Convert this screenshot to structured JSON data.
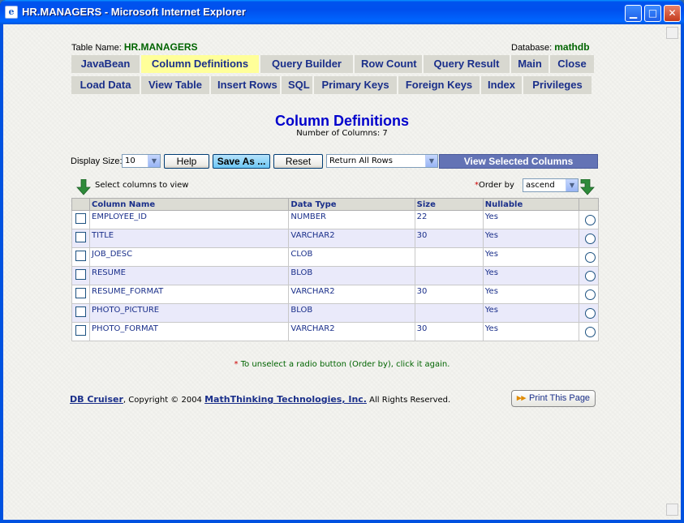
{
  "window": {
    "title": "HR.MANAGERS - Microsoft Internet Explorer"
  },
  "header": {
    "table_name_label": "Table Name:",
    "table_name": "HR.MANAGERS",
    "database_label": "Database:",
    "database": "mathdb"
  },
  "nav_row1": [
    "JavaBean",
    "Column Definitions",
    "Query Builder",
    "Row Count",
    "Query Result",
    "Main",
    "Close"
  ],
  "nav_row2": [
    "Load Data",
    "View Table",
    "Insert Rows",
    "SQL",
    "Primary Keys",
    "Foreign Keys",
    "Index",
    "Privileges"
  ],
  "page": {
    "title": "Column Definitions",
    "subtitle": "Number of Columns: 7"
  },
  "controls": {
    "display_size_label": "Display Size:",
    "display_size_value": "10",
    "help": "Help",
    "save_as": "Save As ...",
    "reset": "Reset",
    "rows_select": "Return All Rows",
    "view_selected": "View Selected Columns",
    "select_cols_label": "Select columns to view",
    "order_by_star": "*",
    "order_by_label": "Order by",
    "order_value": "ascend"
  },
  "table": {
    "headers": [
      "Column Name",
      "Data Type",
      "Size",
      "Nullable"
    ],
    "rows": [
      {
        "name": "EMPLOYEE_ID",
        "type": "NUMBER",
        "size": "22",
        "nullable": "Yes"
      },
      {
        "name": "TITLE",
        "type": "VARCHAR2",
        "size": "30",
        "nullable": "Yes"
      },
      {
        "name": "JOB_DESC",
        "type": "CLOB",
        "size": "",
        "nullable": "Yes"
      },
      {
        "name": "RESUME",
        "type": "BLOB",
        "size": "",
        "nullable": "Yes"
      },
      {
        "name": "RESUME_FORMAT",
        "type": "VARCHAR2",
        "size": "30",
        "nullable": "Yes"
      },
      {
        "name": "PHOTO_PICTURE",
        "type": "BLOB",
        "size": "",
        "nullable": "Yes"
      },
      {
        "name": "PHOTO_FORMAT",
        "type": "VARCHAR2",
        "size": "30",
        "nullable": "Yes"
      }
    ]
  },
  "note": {
    "star": "*",
    "text": " To unselect a radio button (Order by), click it again."
  },
  "footer": {
    "product": "DB Cruiser",
    "copyright": ",  Copyright © 2004 ",
    "company": "MathThinking Technologies, Inc.",
    "rights": "  All Rights Reserved.",
    "print": "Print This Page"
  },
  "colors": {
    "accent_title": "#0000cc",
    "nav_active": "#ffff99",
    "view_selected_bg": "#6373b5"
  }
}
